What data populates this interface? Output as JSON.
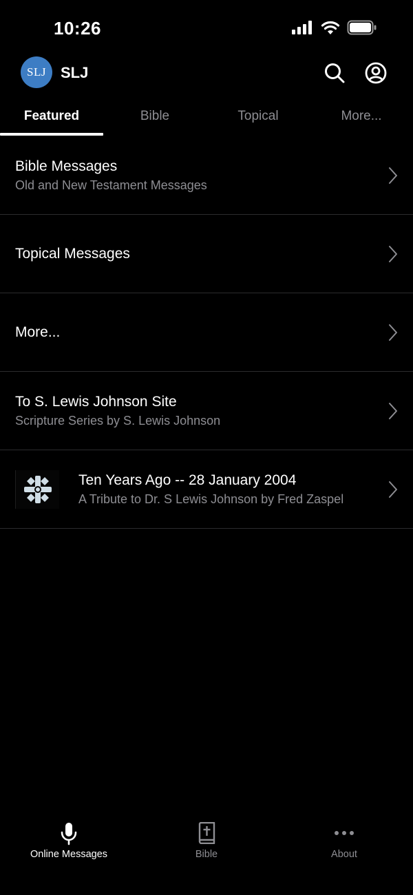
{
  "status": {
    "time": "10:26"
  },
  "header": {
    "avatar_text": "SLJ",
    "title": "SLJ"
  },
  "tabs": [
    {
      "label": "Featured",
      "active": true
    },
    {
      "label": "Bible",
      "active": false
    },
    {
      "label": "Topical",
      "active": false
    },
    {
      "label": "More...",
      "active": false
    }
  ],
  "list": [
    {
      "title": "Bible Messages",
      "subtitle": "Old and New Testament Messages"
    },
    {
      "title": "Topical Messages",
      "subtitle": ""
    },
    {
      "title": "More...",
      "subtitle": ""
    },
    {
      "title": "To S. Lewis Johnson Site",
      "subtitle": "Scripture Series by S. Lewis Johnson"
    },
    {
      "title": "Ten Years Ago -- 28 January 2004",
      "subtitle": "A Tribute to Dr. S Lewis Johnson by Fred Zaspel",
      "thumbnail": "cross-emblem-icon"
    }
  ],
  "bottom_nav": [
    {
      "label": "Online Messages",
      "icon": "microphone-icon",
      "active": true
    },
    {
      "label": "Bible",
      "icon": "bible-icon",
      "active": false
    },
    {
      "label": "About",
      "icon": "more-dots-icon",
      "active": false
    }
  ],
  "colors": {
    "background": "#000000",
    "avatar": "#3d7dc4",
    "secondary_text": "#8e8e93",
    "divider": "#2c2c2e"
  }
}
